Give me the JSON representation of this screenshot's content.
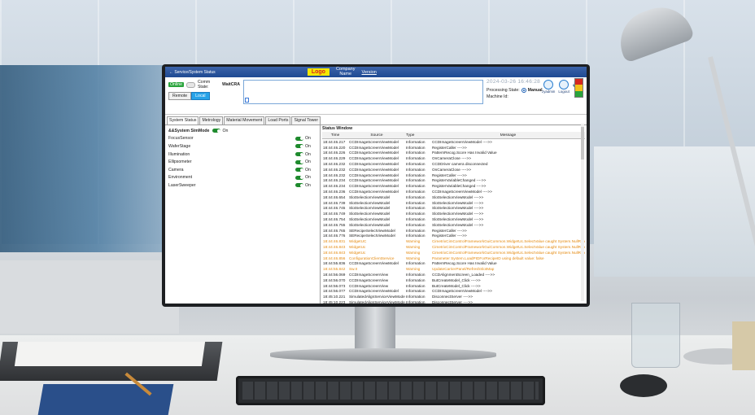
{
  "app": {
    "title": "Service/System Status",
    "logo": "Logo",
    "company_line1": "Company",
    "company_line2": "Name",
    "version_label": "Version"
  },
  "topbar": {
    "online_badge": "Online",
    "comm_state_label": "Comm State:",
    "comm_state_value": "WaitCRA",
    "remote_button": "Remote",
    "local_button": "Local",
    "datetime": "2024-03-26  16:46:28",
    "processing_state_label": "Processing State:",
    "processing_state_value": "Manual",
    "machine_id_label": "Machine Id:",
    "user_label": "zyadmin",
    "logout_label": "Logout",
    "off_label": "Off",
    "stack_light_colors": [
      "#d6281e",
      "#f2c21b",
      "#2aa43c"
    ]
  },
  "tabs": [
    "System Status",
    "Metrology",
    "Material Movement",
    "Load Ports",
    "Signal Tower"
  ],
  "left": {
    "sim_mode_label": "&&System SimMode",
    "sim_mode_state": "On",
    "settings": [
      {
        "name": "FocusSensor",
        "state": "On"
      },
      {
        "name": "WaferStage",
        "state": "On"
      },
      {
        "name": "Illumination",
        "state": "On"
      },
      {
        "name": "Ellipsometer",
        "state": "On"
      },
      {
        "name": "Camera",
        "state": "On"
      },
      {
        "name": "Environment",
        "state": "On"
      },
      {
        "name": "LaserSweeper",
        "state": "On"
      }
    ]
  },
  "status_window": {
    "title": "Status Window",
    "columns": [
      "Time",
      "Source",
      "Type",
      "Message"
    ],
    "rows": [
      [
        "18:44:46.217",
        "CCDImageScreenViewModel",
        "Information",
        "CCDImageScreenViewModel ---->>"
      ],
      [
        "18:44:46.220",
        "CCDImageScreenViewModel",
        "Information",
        "RegisterCaller ---->>"
      ],
      [
        "18:44:46.226",
        "CCDImageScreenViewModel",
        "Information",
        "PatternRecog.Score Has Invalid Value"
      ],
      [
        "18:44:46.229",
        "CCDImageScreenViewModel",
        "Information",
        "OnCameraClose ---->>"
      ],
      [
        "18:44:46.232",
        "CCDImageScreenViewModel",
        "Information",
        "CCDDriver camera disconnected"
      ],
      [
        "18:44:46.232",
        "CCDImageScreenViewModel",
        "Information",
        "OnCameraClose ---->>"
      ],
      [
        "18:44:46.232",
        "CCDImageScreenViewModel",
        "Information",
        "RegisterCaller ---->>"
      ],
      [
        "18:44:46.234",
        "CCDImageScreenViewModel",
        "Information",
        "RegisterVariableChanged ---->>"
      ],
      [
        "18:44:46.234",
        "CCDImageScreenViewModel",
        "Information",
        "RegisterVariableChanged ---->>"
      ],
      [
        "18:44:46.236",
        "CCDImageScreenViewModel",
        "Information",
        "CCDImageScreenViewModel ---->>"
      ],
      [
        "18:44:46.654",
        "SlotSelectionViewModel",
        "Information",
        "SlotSelectionViewModel ---->>"
      ],
      [
        "18:44:46.739",
        "SlotSelectionViewModel",
        "Information",
        "SlotSelectionViewModel ---->>"
      ],
      [
        "18:44:46.745",
        "SlotSelectionViewModel",
        "Information",
        "SlotSelectionViewModel ---->>"
      ],
      [
        "18:44:46.749",
        "SlotSelectionViewModel",
        "Information",
        "SlotSelectionViewModel ---->>"
      ],
      [
        "18:44:46.754",
        "SlotSelectionViewModel",
        "Information",
        "SlotSelectionViewModel ---->>"
      ],
      [
        "18:44:46.755",
        "SlotSelectionViewModel",
        "Information",
        "SlotSelectionViewModel ---->>"
      ],
      [
        "18:44:46.765",
        "SERecipeSelectViewModel",
        "Information",
        "RegisterCaller ---->>"
      ],
      [
        "18:44:46.776",
        "SERecipeSelectViewModel",
        "Information",
        "RegisterCaller ---->>"
      ],
      [
        "18:44:46.831",
        "WidgetUC",
        "Warning",
        "CimetrixCimControlFrameworkGuiCommon.WidgetUc.SelectValue caught System.NullRefe"
      ],
      [
        "18:44:46.843",
        "WidgetUc",
        "Warning",
        "CimetrixCimControlFrameworkGuiCommon.WidgetUc.SelectValue caught System.NullRefe"
      ],
      [
        "18:44:46.843",
        "WidgetUc",
        "Warning",
        "CimetrixCimControlFrameworkGuiCommon.WidgetUc.SelectValue caught System.NullRefe"
      ],
      [
        "18:44:46.856",
        "ConfigurationClientService",
        "Warning",
        "Parameter System.LoadPIDForRecipeID using default value: false"
      ],
      [
        "18:44:55.836",
        "CCDImageScreenViewModel",
        "Information",
        "PatternRecog.Score Has Invalid Value"
      ],
      [
        "18:44:55.842",
        "Sw.II",
        "Warning",
        "UpdateCarrierPanel/RefreshSlotMap"
      ],
      [
        "18:44:56.069",
        "CCDImageScreenView",
        "Information",
        "CCDAlignmentScreen_Loaded ---->>"
      ],
      [
        "18:44:56.070",
        "CCDImageScreenView",
        "Information",
        "ButCreateModel_Click ---->>"
      ],
      [
        "18:44:56.073",
        "CCDImageScreenView",
        "Information",
        "ButCreateModel_Click ---->>"
      ],
      [
        "18:44:56.077",
        "CCDImageScreenViewModel",
        "Information",
        "CCDImageScreenViewModel ---->>"
      ],
      [
        "18:45:10.221",
        "SimulatedAlignServiceViewModel",
        "Information",
        "DisconnectServer ---->>"
      ],
      [
        "18:45:10.223",
        "SimulatedAlignServiceViewModel",
        "Information",
        "DisconnectServer ---->>"
      ],
      [
        "18:45:12.094",
        "CCDImageScreenView",
        "Information",
        "CCDAlignmentScreen_Loaded ---->>"
      ]
    ]
  }
}
